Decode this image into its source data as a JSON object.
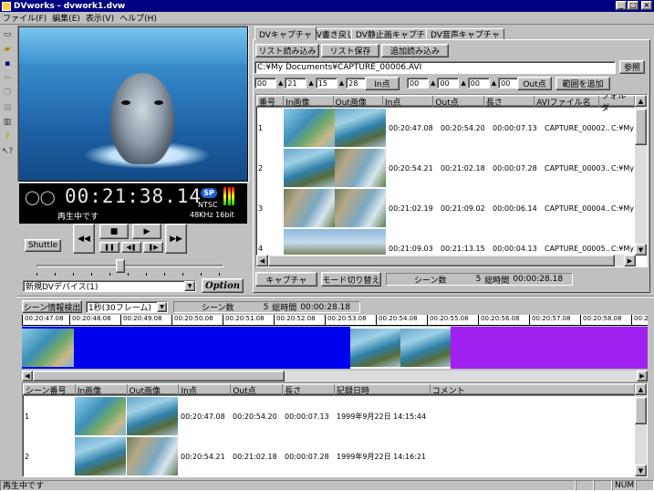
{
  "app": {
    "title": "DVworks - dvwork1.dvw",
    "win_min": "_",
    "win_max": "□",
    "win_close": "×"
  },
  "menu": [
    "ファイル(F)",
    "編集(E)",
    "表示(V)",
    "ヘルプ(H)"
  ],
  "player": {
    "timecode": "00:21:38.14",
    "sp": "SP",
    "format": "NTSC",
    "audio": "48KHz 16bit",
    "status": "再生中です",
    "shuttle": "Shuttle",
    "device": "新規DVデバイス(1)",
    "option": "Option",
    "slider_position": 0.45
  },
  "tabs": [
    "DVキャプチャ",
    "DV書き戻し",
    "DV静止画キャプチャ",
    "DV音声キャプチャ"
  ],
  "capture": {
    "list_load": "リスト読み込み",
    "list_save": "リスト保存",
    "add_load": "追加読み込み",
    "path": "C:¥My Documents¥CAPTURE_00006.AVI",
    "browse": "参照",
    "spin": [
      "00",
      "21",
      "15",
      "28"
    ],
    "in_btn": "In点",
    "spin2": [
      "00",
      "00",
      "00",
      "00"
    ],
    "out_btn": "Out点",
    "range_add": "範囲を追加",
    "capture_btn": "キャプチャ",
    "mode_btn": "モード切り替え",
    "scene_count_label": "シーン数",
    "scene_count": "5",
    "total_label": "総時間",
    "total_time": "00:00:28.18"
  },
  "cap_headers": [
    "番号",
    "In画像",
    "Out画像",
    "In点",
    "Out点",
    "長さ",
    "AVIファイル名",
    "フォルダ"
  ],
  "cap_rows": [
    {
      "no": "1",
      "in": "00:20:47.08",
      "out": "00:20:54.20",
      "len": "00:00:07.13",
      "file": "CAPTURE_00002...",
      "folder": "C:¥My D"
    },
    {
      "no": "2",
      "in": "00:20:54.21",
      "out": "00:21:02.18",
      "len": "00:00:07.28",
      "file": "CAPTURE_00003...",
      "folder": "C:¥My D"
    },
    {
      "no": "3",
      "in": "00:21:02.19",
      "out": "00:21:09.02",
      "len": "00:00:06.14",
      "file": "CAPTURE_00004...",
      "folder": "C:¥My D"
    },
    {
      "no": "4",
      "in": "00:21:09.03",
      "out": "00:21:13.15",
      "len": "00:00:04.13",
      "file": "CAPTURE_00005...",
      "folder": "C:¥My D"
    }
  ],
  "scene": {
    "detect_btn": "シーン情報検出",
    "interval": "1秒(30フレーム)",
    "count_label": "シーン数",
    "count": "5",
    "total_label": "総時間",
    "total": "00:00:28.18"
  },
  "ruler": [
    "00:20:47.08",
    "00:20:48.08",
    "00:20:49.08",
    "00:20:50.08",
    "00:20:51.08",
    "00:20:52.08",
    "00:20:53.08",
    "00:20:54.08",
    "00:20:55.08",
    "00:20:56.08",
    "00:20:57.08",
    "00:20:58.08",
    "00:20:59"
  ],
  "scene_headers": [
    "シーン番号",
    "In画像",
    "Out画像",
    "In点",
    "Out点",
    "長さ",
    "記録日時",
    "コメント"
  ],
  "scene_rows": [
    {
      "no": "1",
      "in": "00:20:47.08",
      "out": "00:20:54.20",
      "len": "00:00:07.13",
      "date": "1999年9月22日 14:15:44"
    },
    {
      "no": "2",
      "in": "00:20:54.21",
      "out": "00:21:02.18",
      "len": "00:00:07.28",
      "date": "1999年9月22日 14:16:21"
    }
  ],
  "statusbar": {
    "text": "再生中です",
    "num": "NUM"
  }
}
